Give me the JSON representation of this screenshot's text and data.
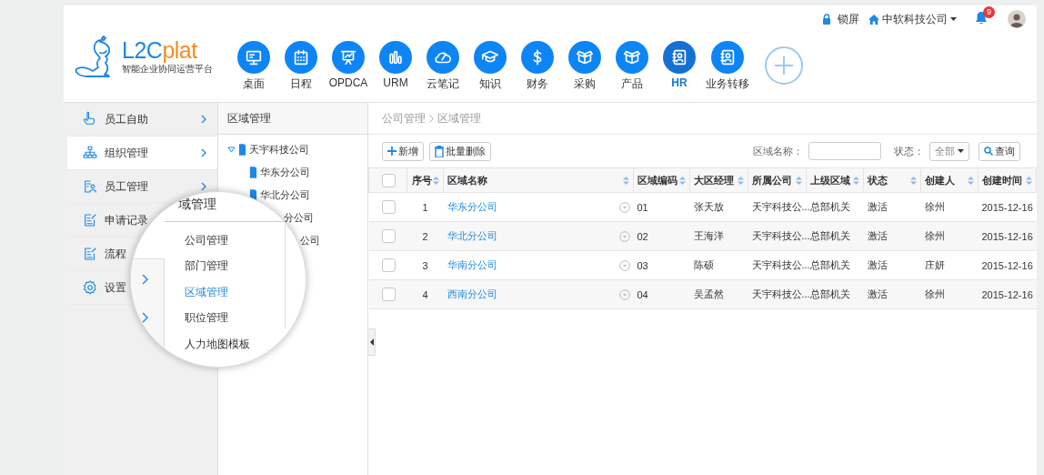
{
  "top_bar": {
    "lock_label": "锁屏",
    "company": "中软科技公司",
    "notifications": "9"
  },
  "logo": {
    "brand_main": "L2C",
    "brand_accent": "plat",
    "tagline": "智能企业协同运营平台"
  },
  "nav": [
    {
      "label": "桌面",
      "selected": false
    },
    {
      "label": "日程",
      "selected": false
    },
    {
      "label": "OPDCA",
      "selected": false
    },
    {
      "label": "URM",
      "selected": false
    },
    {
      "label": "云笔记",
      "selected": false
    },
    {
      "label": "知识",
      "selected": false
    },
    {
      "label": "财务",
      "selected": false
    },
    {
      "label": "采购",
      "selected": false
    },
    {
      "label": "产品",
      "selected": false
    },
    {
      "label": "HR",
      "selected": true
    },
    {
      "label": "业务转移",
      "selected": false
    }
  ],
  "sidebar": {
    "items": [
      {
        "label": "员工自助",
        "selected": false,
        "arrow": true
      },
      {
        "label": "组织管理",
        "selected": true,
        "arrow": true
      },
      {
        "label": "员工管理",
        "selected": false,
        "arrow": true
      },
      {
        "label": "申请记录",
        "selected": false,
        "arrow": false
      },
      {
        "label": "流程",
        "selected": false,
        "arrow": false
      },
      {
        "label": "设置",
        "selected": false,
        "arrow": false
      }
    ]
  },
  "tree": {
    "title": "区域管理",
    "root": {
      "label": "天宇科技公司",
      "expanded": true,
      "children": [
        {
          "label": "华东分公司",
          "covered": false
        },
        {
          "label": "华北分公司",
          "covered": false
        },
        {
          "label": "分公司",
          "covered": true
        },
        {
          "label": "公司",
          "covered": true
        }
      ]
    }
  },
  "breadcrumb": [
    "公司管理",
    "区域管理"
  ],
  "toolbar": {
    "add": "新增",
    "batch_delete": "批量删除",
    "name_label": "区域名称：",
    "status_label": "状态：",
    "status_value": "全部",
    "search": "查询"
  },
  "table": {
    "select_all_checked": false,
    "columns": [
      "序号",
      "区域名称",
      "区域编码",
      "大区经理",
      "所属公司",
      "上级区域",
      "状态",
      "创建人",
      "创建时间"
    ],
    "rows": [
      {
        "checked": false,
        "cells": [
          "1",
          "华东分公司",
          "01",
          "张天放",
          "天宇科技公...",
          "总部机关",
          "激活",
          "徐州",
          "2015-12-16"
        ]
      },
      {
        "checked": false,
        "cells": [
          "2",
          "华北分公司",
          "02",
          "王海洋",
          "天宇科技公...",
          "总部机关",
          "激活",
          "徐州",
          "2015-12-16"
        ]
      },
      {
        "checked": false,
        "cells": [
          "3",
          "华南分公司",
          "03",
          "陈硕",
          "天宇科技公...",
          "总部机关",
          "激活",
          "庄妍",
          "2015-12-16"
        ]
      },
      {
        "checked": false,
        "cells": [
          "4",
          "西南分公司",
          "04",
          "吴孟然",
          "天宇科技公...",
          "总部机关",
          "激活",
          "徐州",
          "2015-12-16"
        ]
      }
    ]
  },
  "magnifier": {
    "header": "域管理",
    "items": [
      {
        "label": "公司管理",
        "selected": false
      },
      {
        "label": "部门管理",
        "selected": false
      },
      {
        "label": "区域管理",
        "selected": true
      },
      {
        "label": "职位管理",
        "selected": false
      },
      {
        "label": "人力地图模板",
        "selected": false
      }
    ]
  }
}
